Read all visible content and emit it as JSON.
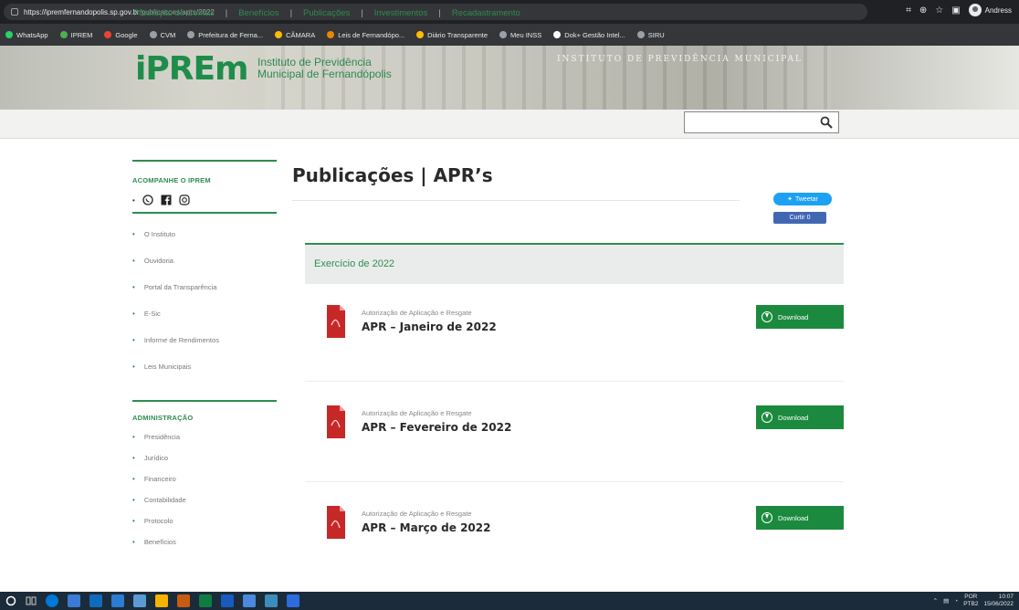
{
  "browser": {
    "url_host": "https://ipremfernandopolis.sp.gov.br",
    "url_path": "/publicacoes/aprs/2022",
    "profile_name": "Andress",
    "bookmarks": [
      {
        "label": "WhatsApp",
        "color": "#25d366"
      },
      {
        "label": "IPREM",
        "color": "#4caf50"
      },
      {
        "label": "Google",
        "color": "#ea4335"
      },
      {
        "label": "CVM",
        "color": "#9aa0a6"
      },
      {
        "label": "Prefeitura de Ferna...",
        "color": "#9aa0a6"
      },
      {
        "label": "CÂMARA",
        "color": "#fbbc04"
      },
      {
        "label": "Leis de Fernandópo...",
        "color": "#ea8600"
      },
      {
        "label": "Diário Transparente",
        "color": "#fbbc04"
      },
      {
        "label": "Meu INSS",
        "color": "#9aa0a6"
      },
      {
        "label": "Dok+ Gestão Intel...",
        "color": "#ffffff"
      },
      {
        "label": "SIRU",
        "color": "#9aa0a6"
      }
    ]
  },
  "header": {
    "logo_text": "iPREm",
    "subtitle_line1": "Instituto de Previdência",
    "subtitle_line2": "Municipal de Fernandópolis",
    "building_text": "INSTITUTO DE PREVIDÊNCIA MUNICIPAL"
  },
  "nav": {
    "items": [
      "Prestação de Contas",
      "Benefícios",
      "Publicações",
      "Investimentos",
      "Recadastramento"
    ],
    "search_placeholder": ""
  },
  "sidebar": {
    "follow_heading": "ACOMPANHE O IPREM",
    "links": [
      "O Instituto",
      "Ouvidoria",
      "Portal da Transparência",
      "E-Sic",
      "Informe de Rendimentos",
      "Leis Municipais"
    ],
    "admin_heading": "ADMINISTRAÇÃO",
    "admin_links": [
      "Presidência",
      "Jurídico",
      "Financeiro",
      "Contabilidade",
      "Protocolo",
      "Benefícios"
    ]
  },
  "main": {
    "title": "Publicações | APR’s",
    "tweet_label": "Tweetar",
    "like_label": "Curtir 0",
    "year_label": "Exercício de 2022",
    "entries": [
      {
        "category": "Autorização de Aplicação e Resgate",
        "title": "APR – Janeiro de 2022",
        "button": "Download"
      },
      {
        "category": "Autorização de Aplicação e Resgate",
        "title": "APR – Fevereiro de 2022",
        "button": "Download"
      },
      {
        "category": "Autorização de Aplicação e Resgate",
        "title": "APR – Março de 2022",
        "button": "Download"
      }
    ]
  },
  "taskbar": {
    "lang": "POR",
    "lang2": "PTB2",
    "time": "10:07",
    "date": "15/06/2022"
  },
  "colors": {
    "brand_green": "#2f8c4f",
    "download_green": "#1c8a3e",
    "pdf_red": "#c62828"
  }
}
